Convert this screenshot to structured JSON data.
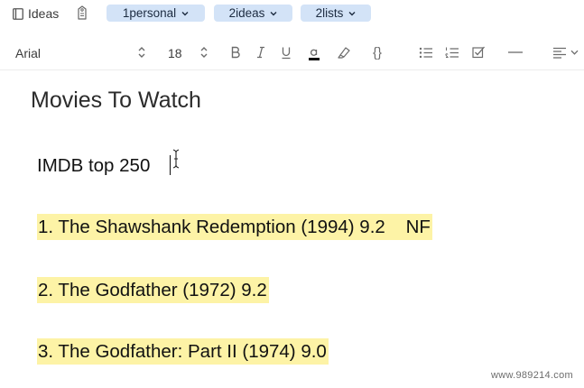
{
  "topbar": {
    "notebook_label": "Ideas",
    "tags": [
      {
        "label": "1personal"
      },
      {
        "label": "2ideas"
      },
      {
        "label": "2lists"
      }
    ]
  },
  "toolbar": {
    "font_family": "Arial",
    "font_size": "18",
    "code_label": "{}"
  },
  "note": {
    "title": "Movies To Watch",
    "paragraphs": [
      "IMDB top 250",
      "1. The Shawshank Redemption (1994) 9.2    NF",
      "2. The Godfather (1972) 9.2",
      "3. The Godfather: Part II (1974) 9.0"
    ]
  },
  "watermark": "www.989214.com",
  "colors": {
    "tag_chip": "#d3e3f7",
    "highlight": "#fdf3a6",
    "toolbar_icon": "#6b6b6b"
  }
}
